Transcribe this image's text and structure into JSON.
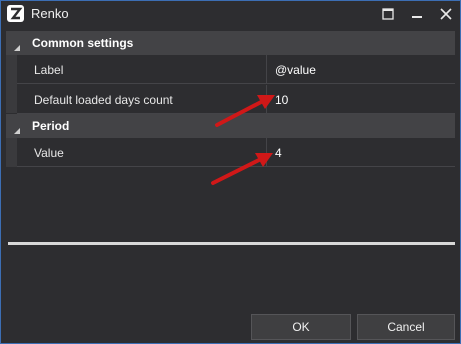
{
  "window": {
    "title": "Renko"
  },
  "titlebar_icons": [
    "app-logo-icon",
    "maximize-icon",
    "minimize-icon",
    "close-icon"
  ],
  "sections": [
    {
      "label": "Common settings",
      "rows": [
        {
          "label": "Label",
          "value": "@value"
        },
        {
          "label": "Default loaded days count",
          "value": "10"
        }
      ]
    },
    {
      "label": "Period",
      "rows": [
        {
          "label": "Value",
          "value": "4"
        }
      ]
    }
  ],
  "buttons": {
    "ok": "OK",
    "cancel": "Cancel"
  },
  "colors": {
    "background": "#2d2d30",
    "section_header": "#434346",
    "border_accent": "#3c6eb4",
    "annotation_arrow": "#d01818"
  }
}
